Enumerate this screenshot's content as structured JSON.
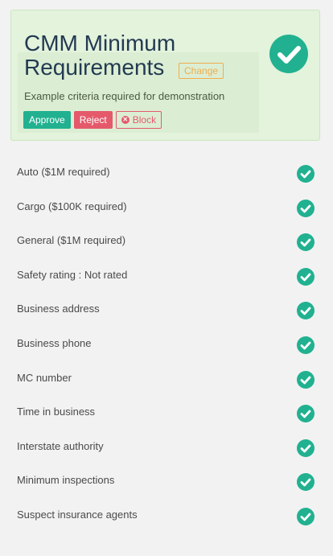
{
  "header": {
    "title": "CMM Minimum Requirements",
    "change_label": "Change",
    "subtitle": "Example criteria required for demonstration",
    "approve_label": "Approve",
    "reject_label": "Reject",
    "block_label": "Block",
    "status_icon": "check-circle-icon"
  },
  "requirements": [
    {
      "label": "Auto ($1M required)",
      "status": "passed"
    },
    {
      "label": "Cargo ($100K required)",
      "status": "passed"
    },
    {
      "label": "General ($1M required)",
      "status": "passed"
    },
    {
      "label": "Safety rating : Not rated",
      "status": "passed"
    },
    {
      "label": "Business address",
      "status": "passed"
    },
    {
      "label": "Business phone",
      "status": "passed"
    },
    {
      "label": "MC number",
      "status": "passed"
    },
    {
      "label": "Time in business",
      "status": "passed"
    },
    {
      "label": "Interstate authority",
      "status": "passed"
    },
    {
      "label": "Minimum inspections",
      "status": "passed"
    },
    {
      "label": "Suspect insurance agents",
      "status": "passed"
    }
  ],
  "colors": {
    "accent_green": "#21b190",
    "reject_red": "#e55a6b",
    "change_orange": "#f0ad4e",
    "title_navy": "#233a52",
    "card_bg": "#e3f3dc"
  }
}
